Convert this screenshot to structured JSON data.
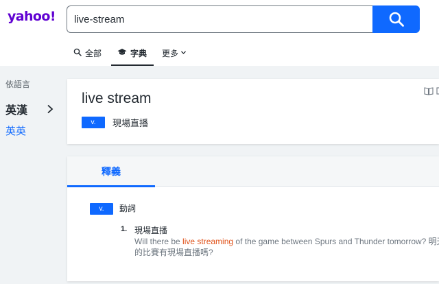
{
  "header": {
    "logo": "yahoo!",
    "search_value": "live-stream",
    "tabs": [
      {
        "label": "全部",
        "icon": "search-icon"
      },
      {
        "label": "字典",
        "icon": "graduation-cap-icon"
      },
      {
        "label": "更多",
        "icon": "chevron-down-icon"
      }
    ]
  },
  "sidebar": {
    "title": "依語言",
    "items": [
      {
        "label": "英漢"
      },
      {
        "label": "英英"
      }
    ]
  },
  "entry": {
    "word": "live stream",
    "pos": "v.",
    "short_def": "現場直播"
  },
  "definition": {
    "tab_label": "釋義",
    "pos": "v.",
    "pos_label": "動詞",
    "senses": [
      {
        "num": "1.",
        "text": "現場直播",
        "example_before": "Will there be ",
        "example_highlight": "live streaming",
        "example_after": " of the game between Spurs and Thunder tomorrow? 明天",
        "example_zh": "的比賽有現場直播嗎?"
      }
    ]
  },
  "colors": {
    "brand": "#6001d2",
    "accent": "#0f69ff",
    "highlight": "#e0531b"
  }
}
